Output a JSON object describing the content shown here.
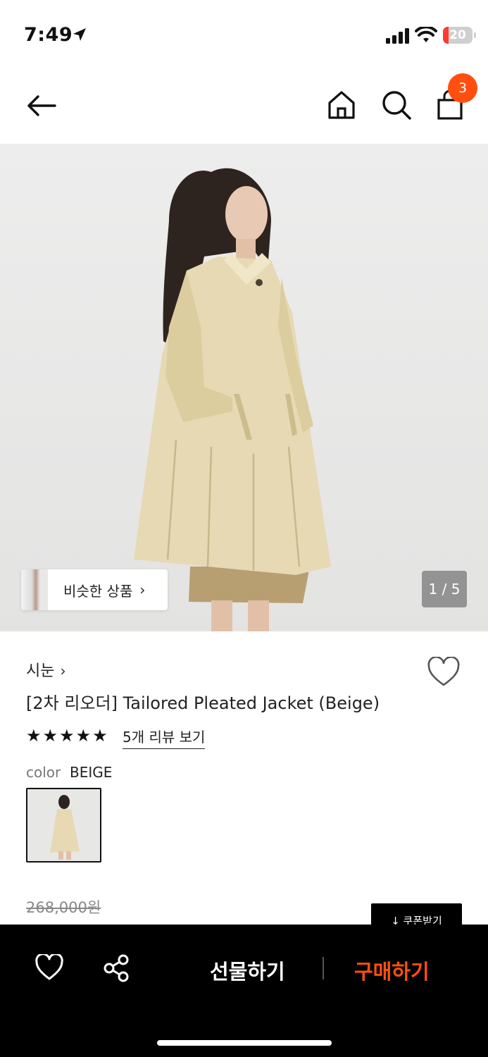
{
  "status_bar": {
    "time": "7:49",
    "battery": "20",
    "icons": [
      "location-arrow-icon",
      "signal-icon",
      "wifi-icon",
      "battery-icon"
    ]
  },
  "nav": {
    "icons": [
      "back-arrow-icon",
      "home-icon",
      "search-icon",
      "shopping-bag-icon"
    ],
    "cart_count": "3"
  },
  "hero": {
    "similar_label": "비슷한 상품",
    "similar_chevron": "›",
    "pager": "1 / 5"
  },
  "product": {
    "brand": "시눈",
    "brand_chevron": "›",
    "title": "[2차 리오더] Tailored Pleated Jacket (Beige)",
    "rating_stars": 5,
    "review_link": "5개 리뷰 보기",
    "color_label": "color",
    "color_value": "BEIGE",
    "original_price": "268,000원",
    "coupon_label": "↓ 쿠폰받기"
  },
  "bottom_bar": {
    "gift_label": "선물하기",
    "buy_label": "구매하기",
    "icons": [
      "heart-icon",
      "share-icon"
    ]
  },
  "colors": {
    "accent": "#ff4f10",
    "bottom_bar_bg": "#000000",
    "coat": "#e6d9b4"
  }
}
